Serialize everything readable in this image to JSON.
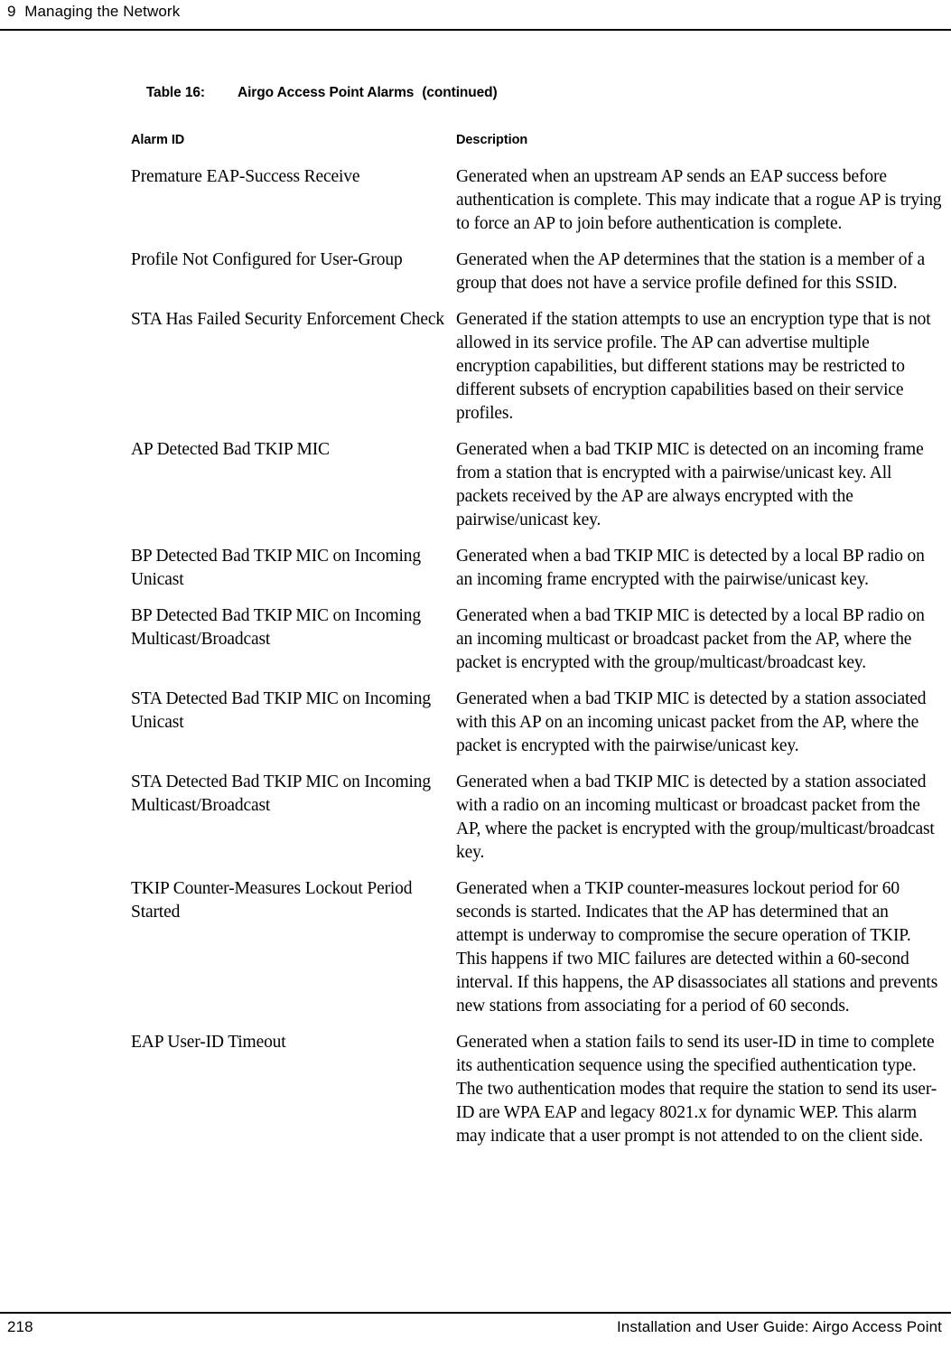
{
  "running_header": "9  Managing the Network",
  "table": {
    "caption_number": "Table 16:",
    "caption_title": "Airgo Access Point Alarms",
    "caption_continued": "(continued)",
    "columns": {
      "alarm_id": "Alarm ID",
      "description": "Description"
    },
    "rows": [
      {
        "alarm_id": "Premature EAP-Success Receive",
        "description": "Generated when an upstream AP sends an EAP success before authentication is complete. This may indicate that a rogue AP is trying to force an AP to join before authentication is complete."
      },
      {
        "alarm_id": "Profile Not Configured for User-Group",
        "description": "Generated when the AP determines that the station is a member of a group that does not have a service profile defined for this SSID."
      },
      {
        "alarm_id": "STA Has Failed Security Enforcement Check",
        "description": "Generated if the station attempts to use an encryption type that is not allowed in its service profile. The AP can advertise multiple encryption capabilities, but different stations may be restricted to different subsets of encryption capabilities based on their service profiles."
      },
      {
        "alarm_id": "AP Detected Bad TKIP MIC",
        "description": "Generated when a bad TKIP MIC is detected on an incoming frame from a station that is encrypted with a pairwise/unicast key. All packets received by the AP are always encrypted with the pairwise/unicast key."
      },
      {
        "alarm_id": "BP Detected Bad TKIP MIC on Incoming Unicast",
        "description": "Generated when a bad TKIP MIC is detected by a local BP radio on an incoming frame encrypted with the pairwise/unicast key."
      },
      {
        "alarm_id": "BP Detected Bad TKIP MIC on Incoming Multicast/Broadcast",
        "description": "Generated when a bad TKIP MIC is detected by a local BP radio on an incoming multicast or broadcast packet from the AP, where the packet is encrypted with the group/multicast/broadcast key."
      },
      {
        "alarm_id": "STA Detected Bad TKIP MIC on Incoming Unicast",
        "description": "Generated when a bad TKIP MIC is detected by a station associated with this AP on an incoming unicast packet from the AP, where the packet is encrypted with the pairwise/unicast key."
      },
      {
        "alarm_id": "STA Detected Bad TKIP MIC on Incoming Multicast/Broadcast",
        "description": "Generated when a bad TKIP MIC is detected by a station associated with a radio on an incoming multicast or broadcast packet from the AP, where the packet is encrypted with the group/multicast/broadcast key."
      },
      {
        "alarm_id": "TKIP Counter-Measures Lockout Period Started",
        "description": "Generated when a TKIP counter-measures lockout period for 60 seconds is started. Indicates that the AP has determined that an attempt is underway to compromise the secure operation of TKIP. This happens if two MIC failures are detected within a 60-second interval. If this happens, the AP disassociates all stations and prevents new stations from associating for a period of 60 seconds."
      },
      {
        "alarm_id": "EAP User-ID Timeout",
        "description": "Generated when a station fails to send its user-ID in time to complete its authentication sequence using the specified authentication type. The two authentication modes that require the station to send its user-ID are WPA EAP and legacy 8021.x for dynamic WEP. This alarm may indicate that a user prompt is not attended to on the client side."
      }
    ]
  },
  "footer": {
    "page_number": "218",
    "guide_title": "Installation and User Guide: Airgo Access Point"
  }
}
